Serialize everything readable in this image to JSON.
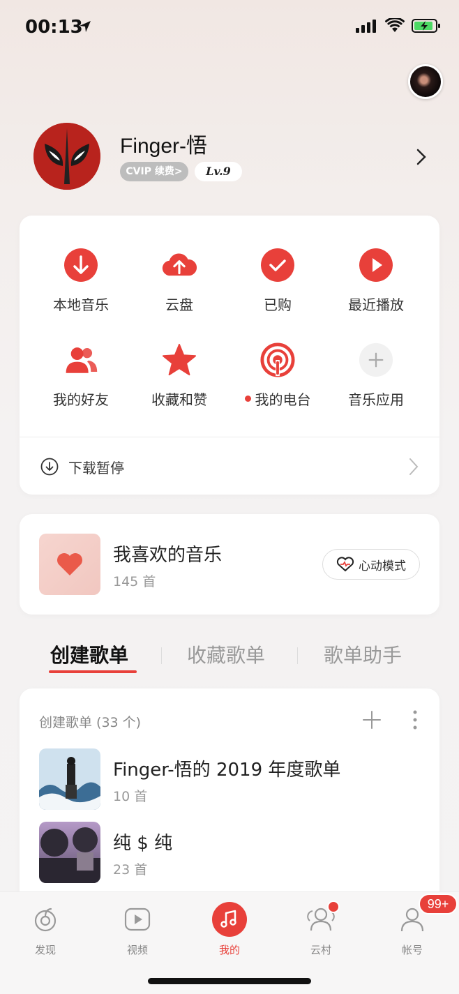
{
  "status": {
    "time": "00:13"
  },
  "profile": {
    "name": "Finger-悟",
    "vip_label": "CVIP 续费>",
    "level_label": "Lv.9"
  },
  "menu": {
    "items": [
      {
        "label": "本地音乐",
        "icon": "download-circle-icon"
      },
      {
        "label": "云盘",
        "icon": "cloud-upload-icon"
      },
      {
        "label": "已购",
        "icon": "check-circle-icon"
      },
      {
        "label": "最近播放",
        "icon": "play-circle-icon"
      },
      {
        "label": "我的好友",
        "icon": "friends-icon"
      },
      {
        "label": "收藏和赞",
        "icon": "star-icon"
      },
      {
        "label": "我的电台",
        "icon": "radio-icon"
      },
      {
        "label": "音乐应用",
        "icon": "plus-circle-icon"
      }
    ],
    "download_label": "下载暂停"
  },
  "liked": {
    "title": "我喜欢的音乐",
    "count": "145 首",
    "heart_mode_label": "心动模式"
  },
  "tabs": [
    {
      "label": "创建歌单",
      "active": true
    },
    {
      "label": "收藏歌单",
      "active": false
    },
    {
      "label": "歌单助手",
      "active": false
    }
  ],
  "playlists": {
    "header": "创建歌单 (33 个)",
    "items": [
      {
        "title": "Finger-悟的 2019 年度歌单",
        "count": "10 首"
      },
      {
        "title": "纯 $ 纯",
        "count": "23 首"
      }
    ]
  },
  "tabbar": {
    "items": [
      {
        "label": "发现",
        "icon": "discover-icon"
      },
      {
        "label": "视频",
        "icon": "video-icon"
      },
      {
        "label": "我的",
        "icon": "music-note-icon"
      },
      {
        "label": "云村",
        "icon": "community-icon"
      },
      {
        "label": "帐号",
        "icon": "account-icon"
      }
    ],
    "account_badge": "99+"
  },
  "colors": {
    "accent": "#e8403a",
    "background": "#f4f3f3"
  }
}
